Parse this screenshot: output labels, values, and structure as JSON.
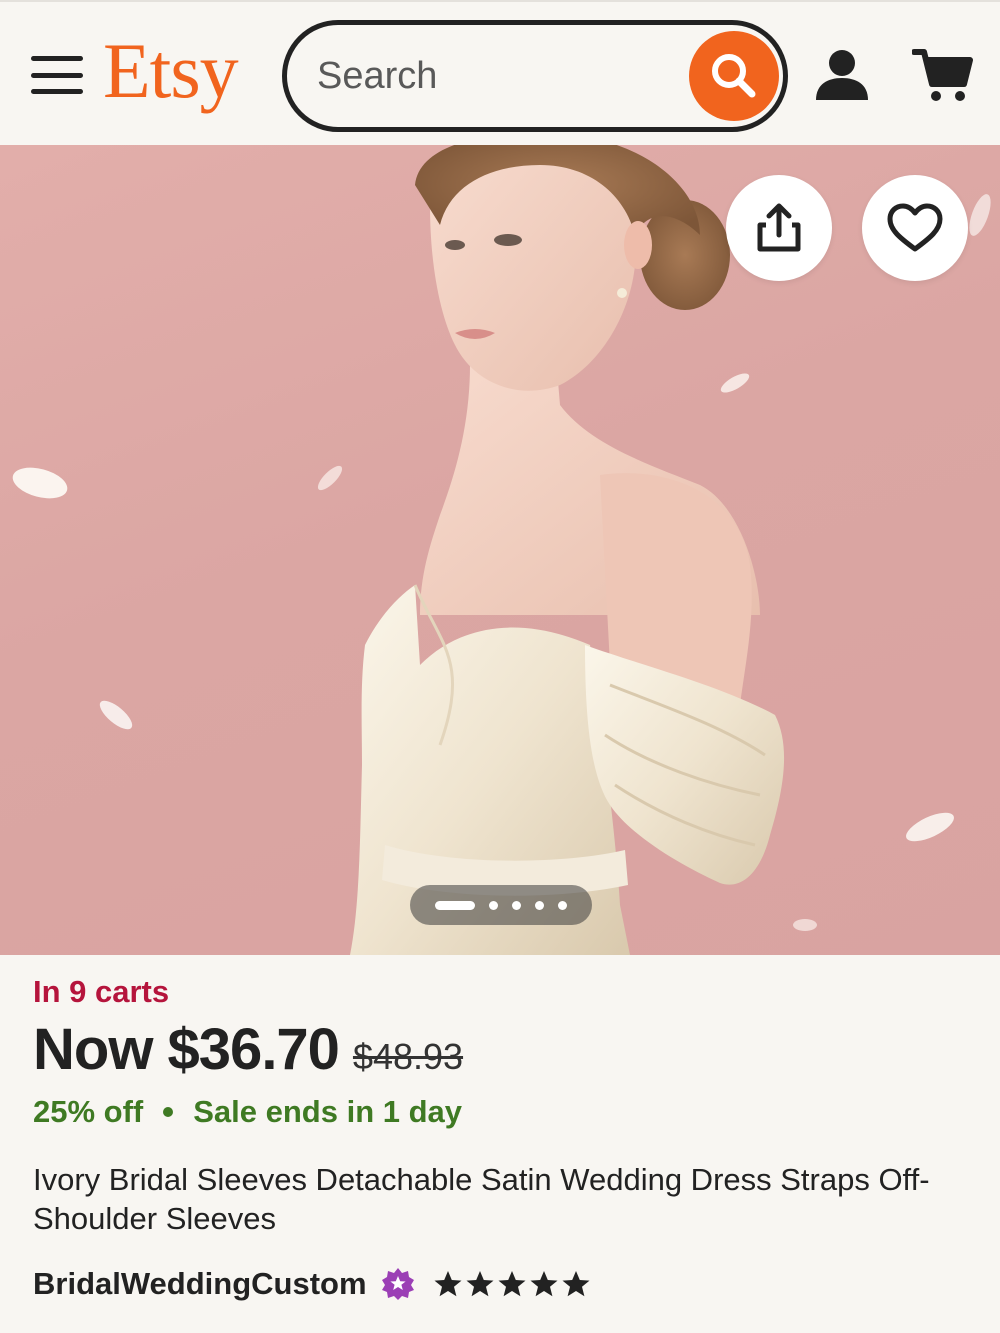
{
  "header": {
    "logo": "Etsy",
    "search_placeholder": "Search"
  },
  "hero": {
    "image_count": 5,
    "active_index": 0
  },
  "listing": {
    "carts_text": "In 9 carts",
    "price_now": "Now $36.70",
    "price_original": "$48.93",
    "discount": "25% off",
    "sale_text": "Sale ends in 1 day",
    "title": "Ivory Bridal Sleeves Detachable Satin Wedding Dress Straps Off-Shoulder Sleeves",
    "shop_name": "BridalWeddingCustom",
    "rating": 5
  },
  "colors": {
    "brand": "#f1641e",
    "carts": "#b5143c",
    "sale": "#3f7a23",
    "star_seller": "#9b3fb5"
  }
}
